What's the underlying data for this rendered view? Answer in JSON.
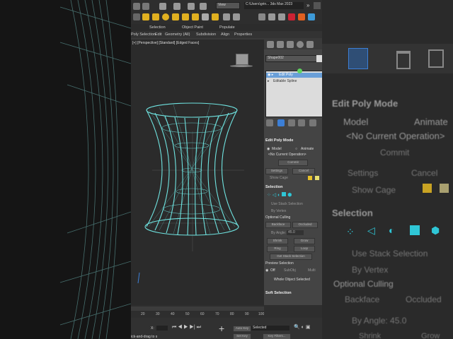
{
  "window": {
    "workspace": "View",
    "path": "C:\\Users\\grin... 3ds Max 2023"
  },
  "ribbon": {
    "tabs": [
      "Selection",
      "Object Paint",
      "Populate"
    ],
    "subtabs": [
      "Poly Selection",
      "Edit",
      "Geometry (All)",
      "Subdivision",
      "Align",
      "Properties"
    ]
  },
  "viewport": {
    "label": "[+] [Perspective] [Standard] [Edged Faces]"
  },
  "command_panel": {
    "object_name": "Shape002",
    "stack": [
      "Edit Poly",
      "Editable Spline"
    ],
    "edit_poly_mode": {
      "title": "Edit Poly Mode",
      "model": "Model",
      "animate": "Animate",
      "no_op": "<No Current Operation>",
      "commit": "Commit",
      "settings": "Settings",
      "cancel": "Cancel",
      "show_cage": "Show Cage"
    },
    "selection": {
      "title": "Selection",
      "use_stack": "Use Stack Selection",
      "by_vertex": "By Vertex",
      "optional_culling": "Optional Culling",
      "backface": "Backface",
      "occluded": "Occluded",
      "by_angle_label": "By Angle:",
      "by_angle_value": "45.0",
      "shrink": "Shrink",
      "grow": "Grow",
      "ring": "Ring",
      "loop": "Loop",
      "get_stack": "Get Stack Selection",
      "preview": "Preview Selection",
      "off": "Off",
      "subobj": "SubObj",
      "multi": "Multi",
      "whole_object": "Whole Object Selected"
    },
    "soft_selection": "Soft Selection"
  },
  "timeline": {
    "ticks": [
      "20",
      "30",
      "40",
      "50",
      "60",
      "70",
      "80",
      "90",
      "100"
    ]
  },
  "statusbar": {
    "x_label": "X:",
    "auto_key": "Auto Key",
    "selected": "Selected",
    "set_key": "Set Key",
    "key_filters": "Key Filters...",
    "prompt": "ick-and-drag to s"
  },
  "right_zoom": {
    "edit_poly_mode": "Edit Poly Mode",
    "model": "Model",
    "animate": "Animate",
    "no_op": "<No Current Operation>",
    "commit": "Commit",
    "settings": "Settings",
    "cancel": "Cancel",
    "show_cage": "Show Cage",
    "selection": "Selection",
    "use_stack": "Use Stack Selection",
    "by_vertex": "By Vertex",
    "optional_culling": "Optional Culling",
    "backface": "Backface",
    "occluded": "Occluded",
    "by_angle": "By Angle: 45.0",
    "shrink": "Shrink",
    "grow": "Grow"
  },
  "colors": {
    "mesh": "#6fe3e0",
    "accent": "#3c7fd6",
    "cage_yellow": "#e8c028"
  }
}
